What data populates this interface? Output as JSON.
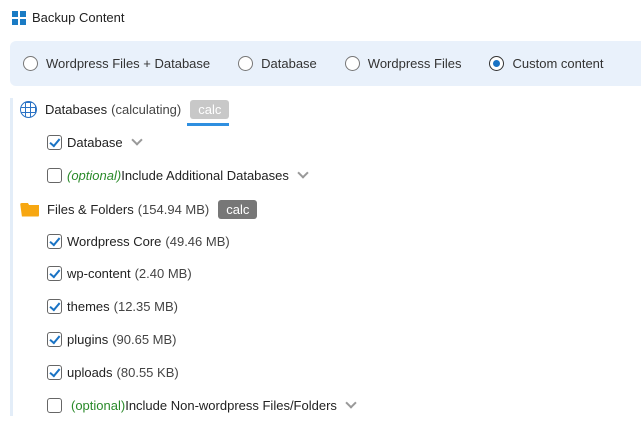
{
  "header": {
    "title": "Backup Content",
    "icon": "grid-icon"
  },
  "backup_type": {
    "options": [
      {
        "label": "Wordpress Files + Database",
        "selected": false
      },
      {
        "label": "Database",
        "selected": false
      },
      {
        "label": "Wordpress Files",
        "selected": false
      },
      {
        "label": "Custom content",
        "selected": true
      }
    ]
  },
  "databases": {
    "label": "Databases",
    "status": "(calculating)",
    "calc_label": "calc",
    "items": [
      {
        "label": "Database",
        "checked": true
      },
      {
        "optional": "(optional)",
        "label": "Include Additional Databases",
        "checked": false
      }
    ]
  },
  "files": {
    "label": "Files & Folders",
    "size": "(154.94 MB)",
    "calc_label": "calc",
    "items": [
      {
        "label": "Wordpress Core",
        "size": "(49.46 MB)",
        "checked": true
      },
      {
        "label": "wp-content",
        "size": "(2.40 MB)",
        "checked": true
      },
      {
        "label": "themes",
        "size": "(12.35 MB)",
        "checked": true
      },
      {
        "label": "plugins",
        "size": "(90.65 MB)",
        "checked": true
      },
      {
        "label": "uploads",
        "size": "(80.55 KB)",
        "checked": true
      }
    ],
    "optional_item": {
      "optional": "(optional)",
      "label": "Include Non-wordpress Files/Folders",
      "checked": false
    }
  },
  "colors": {
    "accent": "#1a73c4",
    "optional": "#2a8a2a",
    "panel": "#e9f1fb"
  }
}
